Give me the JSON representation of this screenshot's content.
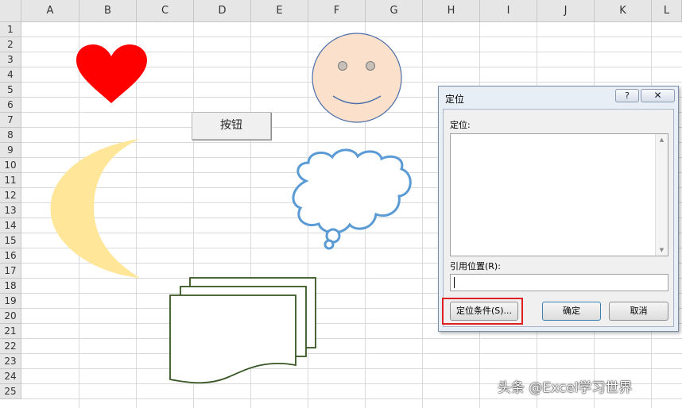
{
  "columns": [
    "A",
    "B",
    "C",
    "D",
    "E",
    "F",
    "G",
    "H",
    "I",
    "J",
    "K",
    "L"
  ],
  "rows": [
    "1",
    "2",
    "3",
    "4",
    "5",
    "6",
    "7",
    "8",
    "9",
    "10",
    "11",
    "12",
    "13",
    "14",
    "15",
    "16",
    "17",
    "18",
    "19",
    "20",
    "21",
    "22",
    "23",
    "24",
    "25"
  ],
  "button_shape": {
    "label": "按钮"
  },
  "dialog": {
    "title": "定位",
    "help_label": "?",
    "close_label": "✕",
    "goto_label": "定位:",
    "reference_label": "引用位置(R):",
    "reference_value": "",
    "special_button": "定位条件(S)...",
    "ok_button": "确定",
    "cancel_button": "取消"
  },
  "watermark": "头条 @Excel学习世界",
  "colors": {
    "heart": "#ff0000",
    "moon": "#ffe699",
    "smiley_fill": "#fbe0cc",
    "smiley_stroke": "#4d6fa8",
    "cloud_stroke": "#5b9bd5",
    "document_stroke": "#375623",
    "highlight": "#e02020"
  }
}
